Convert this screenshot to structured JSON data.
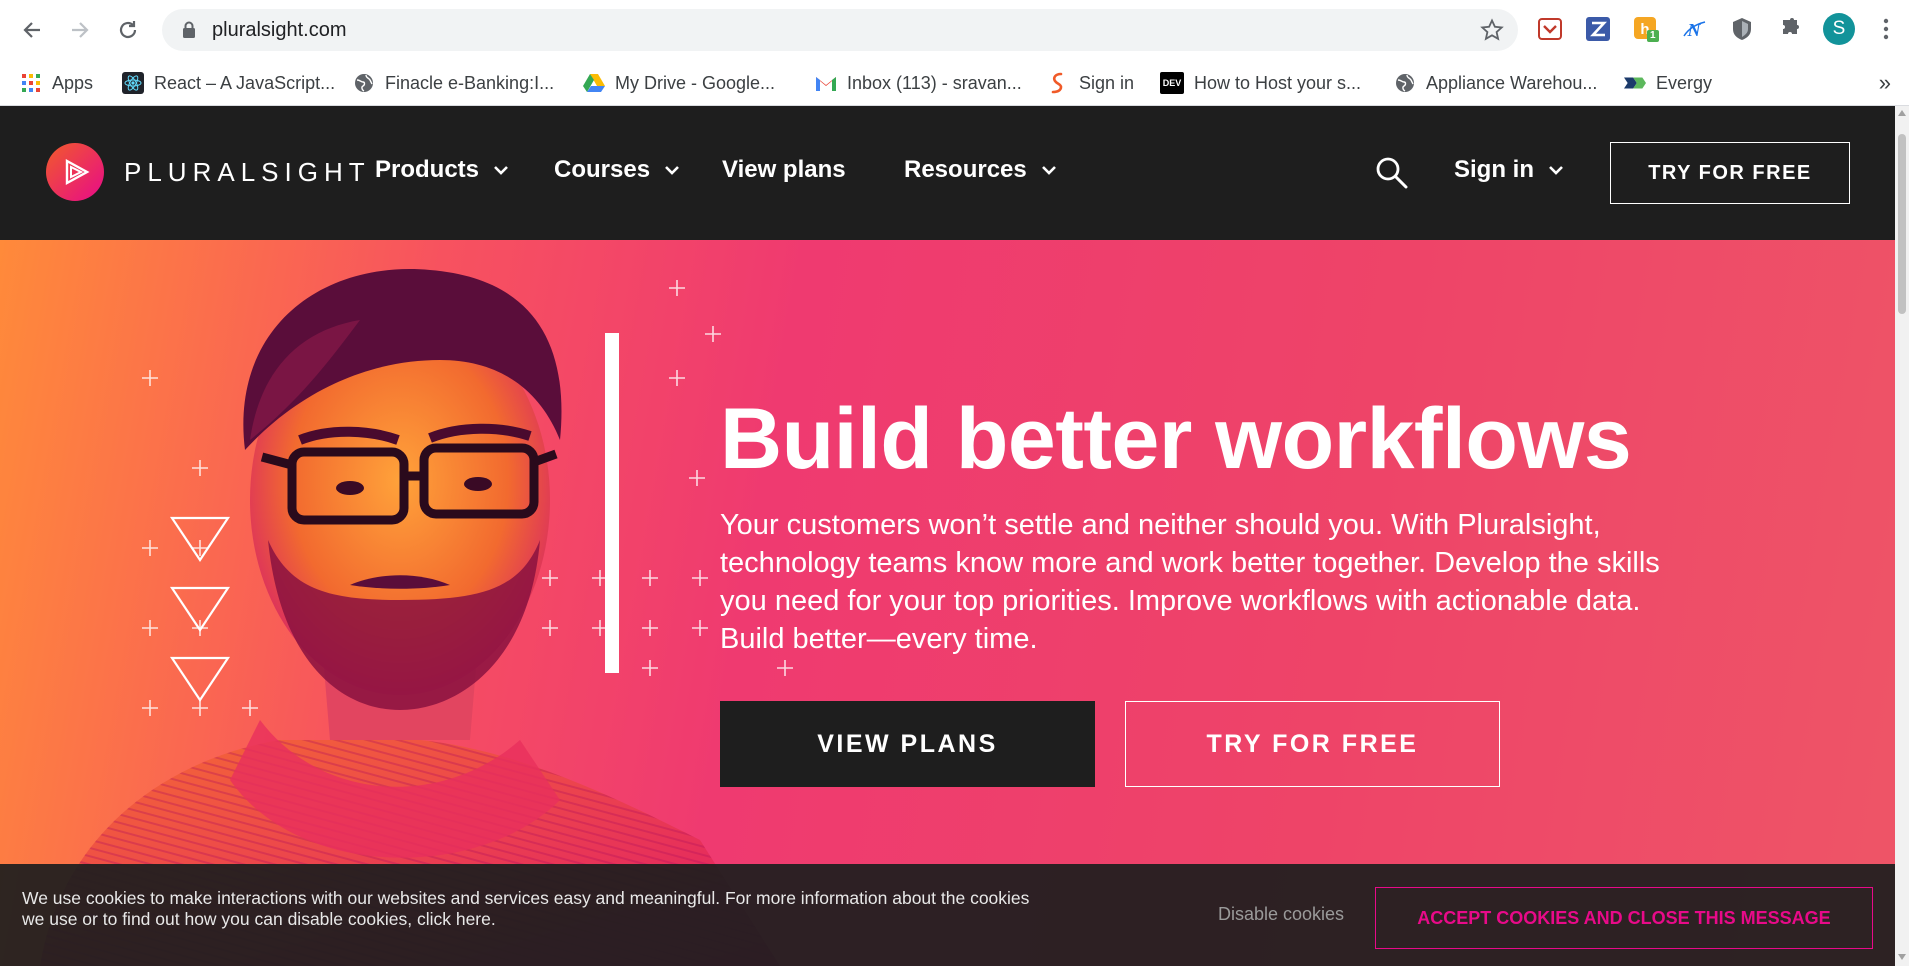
{
  "browser": {
    "url": "pluralsight.com",
    "avatar_letter": "S",
    "extension_badge": "1",
    "bookmarks": [
      {
        "label": "Apps",
        "icon": "apps-grid-icon"
      },
      {
        "label": "React – A JavaScript...",
        "icon": "react-icon"
      },
      {
        "label": "Finacle e-Banking:I...",
        "icon": "globe-icon"
      },
      {
        "label": "My Drive - Google...",
        "icon": "google-drive-icon"
      },
      {
        "label": "Inbox (113) - sravan...",
        "icon": "gmail-icon"
      },
      {
        "label": "Sign in",
        "icon": "sign-in-icon"
      },
      {
        "label": "How to Host your s...",
        "icon": "dev-icon"
      },
      {
        "label": "Appliance Warehou...",
        "icon": "globe-icon"
      },
      {
        "label": "Evergy",
        "icon": "evergy-icon"
      }
    ],
    "bookmarks_more": "»",
    "dev_icon_text": "DEV"
  },
  "nav": {
    "logo_text": "PLURALSIGHT",
    "items": [
      {
        "label": "Products"
      },
      {
        "label": "Courses"
      },
      {
        "label": "View plans"
      },
      {
        "label": "Resources"
      }
    ],
    "sign_in": "Sign in",
    "cta": "TRY FOR FREE"
  },
  "hero": {
    "title": "Build better workflows",
    "body": "Your customers won’t settle and neither should you. With Pluralsight, technology teams know more and work better together. Develop the skills you need for your top priorities. Improve workflows with actionable data. Build better—every time.",
    "primary_button": "VIEW PLANS",
    "secondary_button": "TRY FOR FREE"
  },
  "cookie_banner": {
    "text": "We use cookies to make interactions with our websites and services easy and meaningful. For more information about the cookies we use or to find out how you can disable cookies, click here.",
    "disable_label": "Disable cookies",
    "accept_label": "ACCEPT COOKIES AND CLOSE THIS MESSAGE"
  },
  "colors": {
    "brand_pink": "#e80a89",
    "brand_orange": "#f15b2a",
    "nav_bg": "#1e1e1e"
  }
}
